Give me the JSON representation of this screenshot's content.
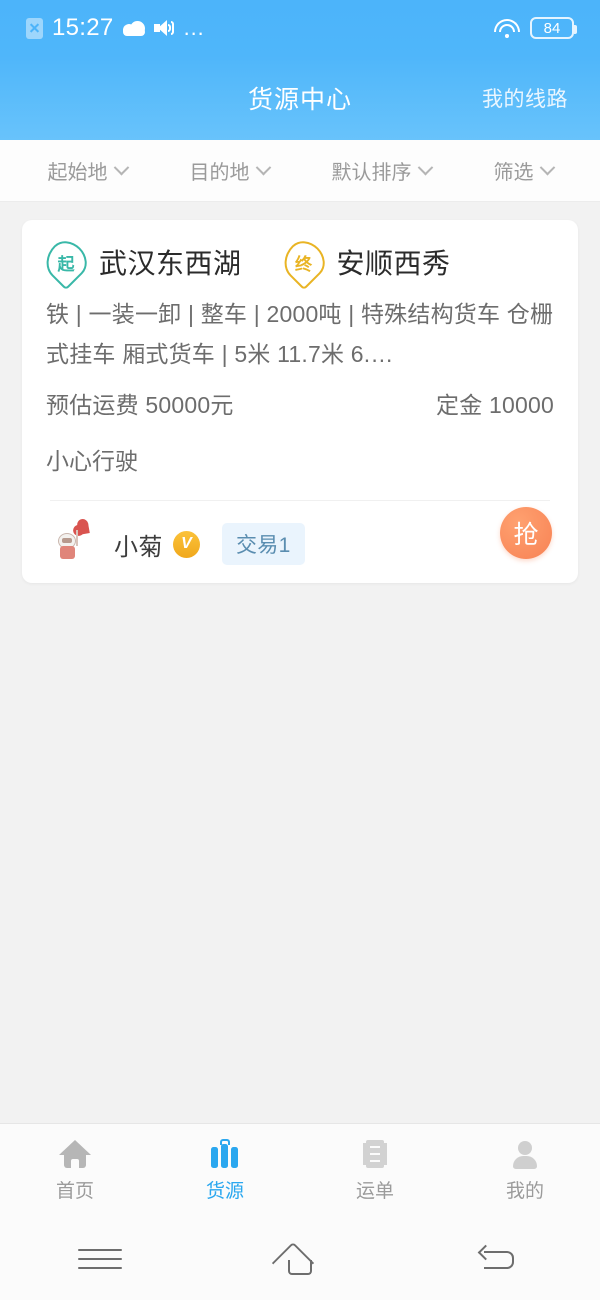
{
  "status_bar": {
    "sim_icon": "sim-card-icon",
    "time": "15:27",
    "weather_icon": "cloud-icon",
    "volume_icon": "volume-icon",
    "more_icon": "…",
    "wifi_icon": "wifi-icon",
    "battery_level": "84"
  },
  "header": {
    "title": "货源中心",
    "action_label": "我的线路"
  },
  "filters": [
    {
      "label": "起始地",
      "icon": "chevron-down-icon"
    },
    {
      "label": "目的地",
      "icon": "chevron-down-icon"
    },
    {
      "label": "默认排序",
      "icon": "chevron-down-icon"
    },
    {
      "label": "筛选",
      "icon": "chevron-down-icon"
    }
  ],
  "card": {
    "start_badge": "起",
    "start_place": "武汉东西湖",
    "end_badge": "终",
    "end_place": "安顺西秀",
    "description": "铁 | 一装一卸 | 整车 | 2000吨 | 特殊结构货车 仓栅式挂车 厢式货车 | 5米 11.7米 6.…",
    "freight_label": "预估运费 50000元",
    "deposit_label": "定金 10000",
    "remark": "小心行驶",
    "user_name": "小菊",
    "verified_badge": "V",
    "trade_tag": "交易1",
    "grab_button": "抢",
    "avatar_icon": "user-avatar-cartoon"
  },
  "tabbar": [
    {
      "label": "首页",
      "icon": "home-icon",
      "active": false
    },
    {
      "label": "货源",
      "icon": "cargo-icon",
      "active": true
    },
    {
      "label": "运单",
      "icon": "waybill-icon",
      "active": false
    },
    {
      "label": "我的",
      "icon": "person-icon",
      "active": false
    }
  ],
  "navbar": [
    {
      "icon": "menu-icon"
    },
    {
      "icon": "home-outline-icon"
    },
    {
      "icon": "back-icon"
    }
  ],
  "colors": {
    "brand_blue": "#4fb6fa",
    "accent_blue": "#2aa7ef",
    "start_pin": "#39b8a8",
    "end_pin": "#e9b424",
    "grab_orange": "#f78254",
    "page_bg": "#f2f2f2"
  }
}
